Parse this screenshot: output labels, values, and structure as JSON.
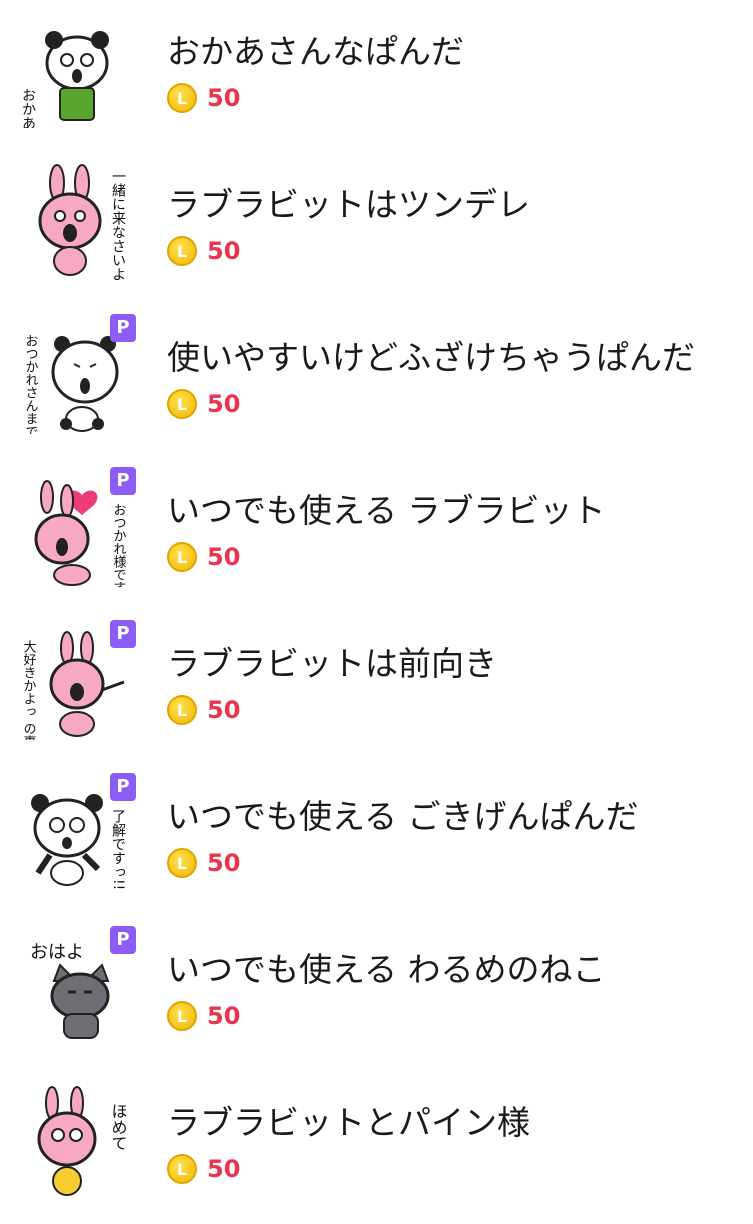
{
  "stickers": [
    {
      "title": "おかあさんなぱんだ",
      "price": "50",
      "premium": false,
      "thumb_text": "おかあさん 登場っ",
      "character": "panda-mother-icon"
    },
    {
      "title": "ラブラビットはツンデレ",
      "price": "50",
      "premium": false,
      "thumb_text": "一緒に来なさいよ",
      "character": "pink-rabbit-icon"
    },
    {
      "title": "使いやすいけどふざけちゃうぱんだ",
      "price": "50",
      "premium": true,
      "premium_label": "P",
      "thumb_text": "おつかれさんまでした",
      "character": "panda-icon"
    },
    {
      "title": "いつでも使える ラブラビット",
      "price": "50",
      "premium": true,
      "premium_label": "P",
      "thumb_text": "おつかれ様ですっ",
      "character": "pink-rabbit-icon"
    },
    {
      "title": "ラブラビットは前向き",
      "price": "50",
      "premium": true,
      "premium_label": "P",
      "thumb_text": "大好きかよっ の事",
      "character": "pink-rabbit-icon"
    },
    {
      "title": "いつでも使える ごきげんぱんだ",
      "price": "50",
      "premium": true,
      "premium_label": "P",
      "thumb_text": "了解ですっ!!",
      "character": "panda-icon"
    },
    {
      "title": "いつでも使える わるめのねこ",
      "price": "50",
      "premium": true,
      "premium_label": "P",
      "thumb_text": "おはよ",
      "character": "gray-cat-icon"
    },
    {
      "title": "ラブラビットとパイン様",
      "price": "50",
      "premium": false,
      "thumb_text": "ほめて",
      "character": "pink-rabbit-icon"
    }
  ],
  "coin_symbol": "L",
  "colors": {
    "price": "#e8344e",
    "coin": "#f2b705",
    "premium_badge": "#8b5cf6"
  }
}
